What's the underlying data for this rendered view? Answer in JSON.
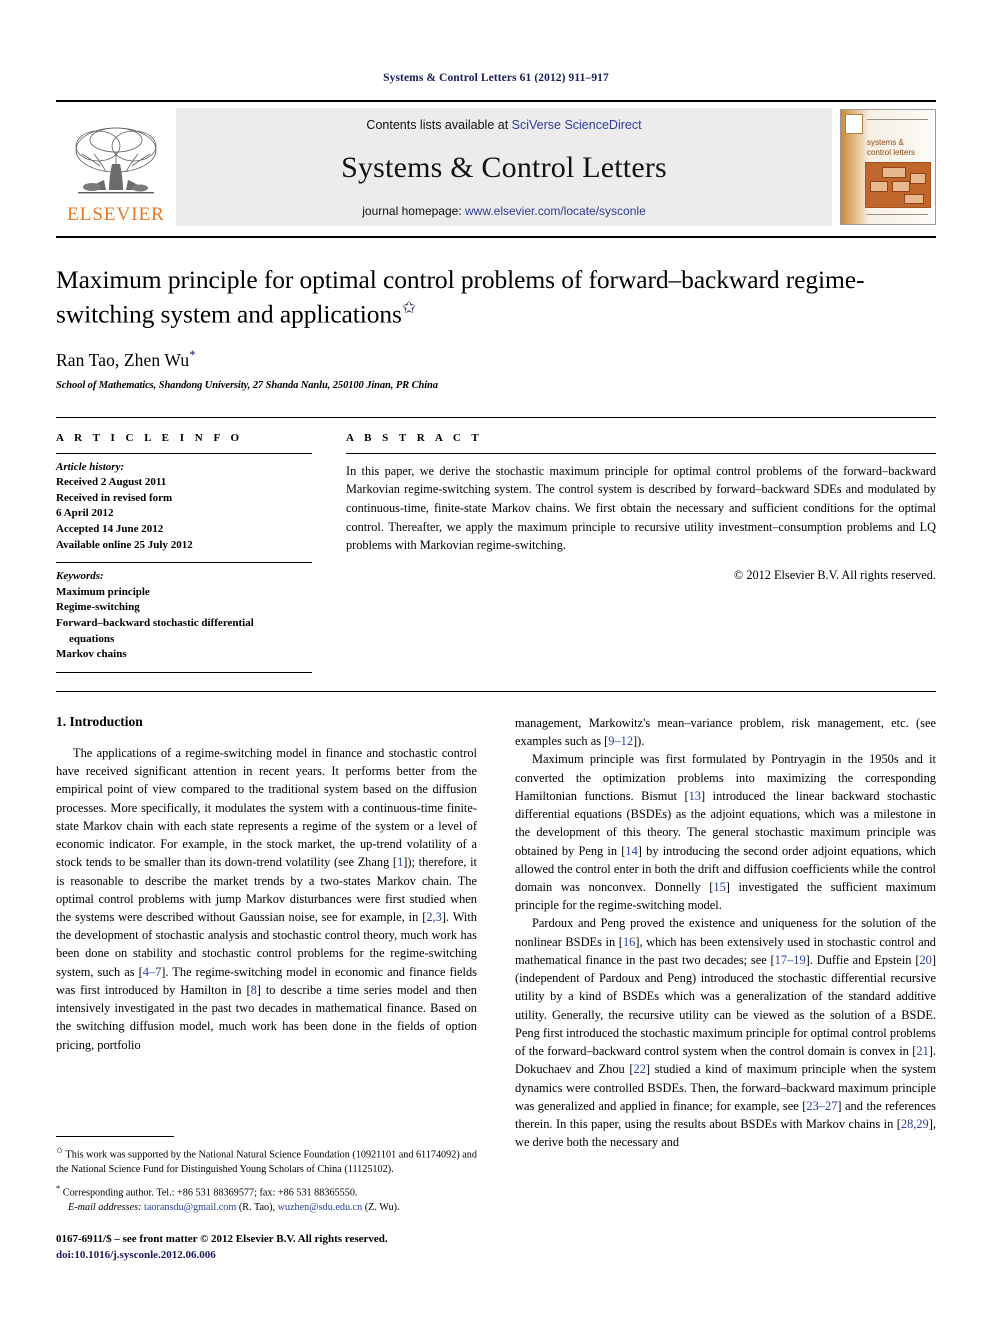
{
  "running_head": "Systems & Control Letters 61 (2012) 911–917",
  "banner": {
    "contents_prefix": "Contents lists available at ",
    "contents_link": "SciVerse ScienceDirect",
    "journal_title": "Systems & Control Letters",
    "homepage_prefix": "journal homepage: ",
    "homepage_link": "www.elsevier.com/locate/sysconle",
    "publisher_logo_text": "ELSEVIER",
    "cover_title": "systems & control letters",
    "accent_orange": "#E87722",
    "link_blue": "#2b3f9e"
  },
  "article": {
    "title": "Maximum principle for optimal control problems of forward–backward regime-switching system and applications",
    "title_footnote_mark": "✩",
    "authors": "Ran Tao, Zhen Wu",
    "author_footnote_mark": "*",
    "affiliation": "School of Mathematics, Shandong University, 27 Shanda Nanlu, 250100 Jinan, PR China"
  },
  "info": {
    "label": "A R T I C L E   I N F O",
    "history_label": "Article history:",
    "history": [
      "Received 2 August 2011",
      "Received in revised form",
      "6 April 2012",
      "Accepted 14 June 2012",
      "Available online 25 July 2012"
    ],
    "keywords_label": "Keywords:",
    "keywords": [
      "Maximum principle",
      "Regime-switching",
      "Forward–backward stochastic differential",
      "equations",
      "Markov chains"
    ]
  },
  "abstract": {
    "label": "A B S T R A C T",
    "text": "In this paper, we derive the stochastic maximum principle for optimal control problems of the forward–backward Markovian regime-switching system. The control system is described by forward–backward SDEs and modulated by continuous-time, finite-state Markov chains. We first obtain the necessary and sufficient conditions for the optimal control. Thereafter, we apply the maximum principle to recursive utility investment–consumption problems and LQ problems with Markovian regime-switching.",
    "copyright": "© 2012 Elsevier B.V. All rights reserved."
  },
  "body": {
    "section_heading": "1. Introduction",
    "left_paragraph_1": "The applications of a regime-switching model in finance and stochastic control have received significant attention in recent years. It performs better from the empirical point of view compared to the traditional system based on the diffusion processes. More specifically, it modulates the system with a continuous-time finite-state Markov chain with each state represents a regime of the system or a level of economic indicator. For example, in the stock market, the up-trend volatility of a stock tends to be smaller than its down-trend volatility (see Zhang [1]); therefore, it is reasonable to describe the market trends by a two-states Markov chain. The optimal control problems with jump Markov disturbances were first studied when the systems were described without Gaussian noise, see for example, in [2,3]. With the development of stochastic analysis and stochastic control theory, much work has been done on stability and stochastic control problems for the regime-switching system, such as [4–7]. The regime-switching model in economic and finance fields was first introduced by Hamilton in [8] to describe a time series model and then intensively investigated in the past two decades in mathematical finance. Based on the switching diffusion model, much work has been done in the fields of option pricing, portfolio",
    "right_paragraph_1": "management, Markowitz's mean–variance problem, risk management, etc. (see examples such as [9–12]).",
    "right_paragraph_2": "Maximum principle was first formulated by Pontryagin in the 1950s and it converted the optimization problems into maximizing the corresponding Hamiltonian functions. Bismut [13] introduced the linear backward stochastic differential equations (BSDEs) as the adjoint equations, which was a milestone in the development of this theory. The general stochastic maximum principle was obtained by Peng in [14] by introducing the second order adjoint equations, which allowed the control enter in both the drift and diffusion coefficients while the control domain was nonconvex. Donnelly [15] investigated the sufficient maximum principle for the regime-switching model.",
    "right_paragraph_3": "Pardoux and Peng proved the existence and uniqueness for the solution of the nonlinear BSDEs in [16], which has been extensively used in stochastic control and mathematical finance in the past two decades; see [17–19]. Duffie and Epstein [20] (independent of Pardoux and Peng) introduced the stochastic differential recursive utility by a kind of BSDEs which was a generalization of the standard additive utility. Generally, the recursive utility can be viewed as the solution of a BSDE. Peng first introduced the stochastic maximum principle for optimal control problems of the forward–backward control system when the control domain is convex in [21]. Dokuchaev and Zhou [22] studied a kind of maximum principle when the system dynamics were controlled BSDEs. Then, the forward–backward maximum principle was generalized and applied in finance; for example, see [23–27] and the references therein. In this paper, using the results about BSDEs with Markov chains in [28,29], we derive both the necessary and"
  },
  "footnotes": {
    "funding_mark": "✩",
    "funding": "This work was supported by the National Natural Science Foundation (10921101 and 61174092) and the National Science Fund for Distinguished Young Scholars of China (11125102).",
    "corresponding_mark": "*",
    "corresponding": "Corresponding author. Tel.: +86 531 88369577; fax: +86 531 88365550.",
    "email_label": "E-mail addresses:",
    "email_1": "taoransdu@gmail.com",
    "email_1_owner": "(R. Tao),",
    "email_2": "wuzhen@sdu.edu.cn",
    "email_2_owner": "(Z. Wu)."
  },
  "imprint": {
    "line1": "0167-6911/$ – see front matter © 2012 Elsevier B.V. All rights reserved.",
    "doi": "doi:10.1016/j.sysconle.2012.06.006"
  }
}
